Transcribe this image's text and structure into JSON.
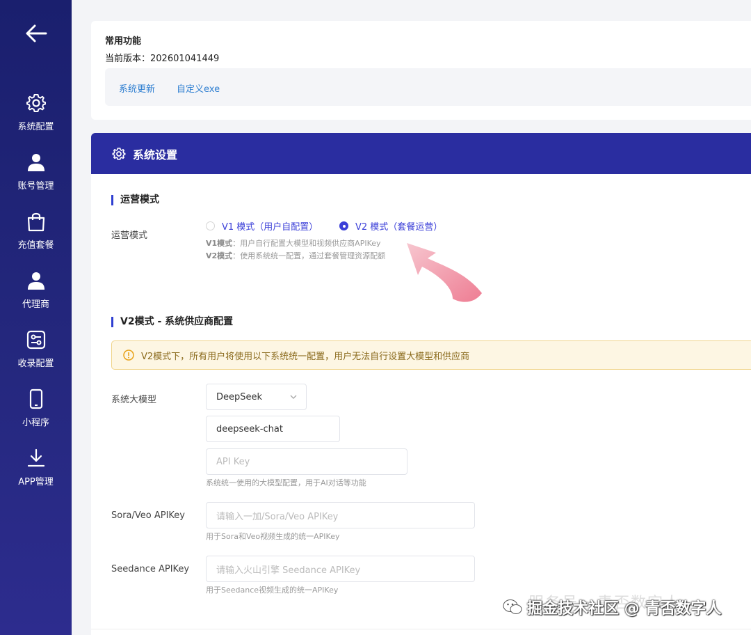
{
  "sidebar": {
    "back_icon": "arrow-left-icon",
    "items": [
      {
        "label": "系统配置",
        "icon": "gear-icon"
      },
      {
        "label": "账号管理",
        "icon": "user-icon"
      },
      {
        "label": "充值套餐",
        "icon": "shopping-bag-icon"
      },
      {
        "label": "代理商",
        "icon": "user-icon"
      },
      {
        "label": "收录配置",
        "icon": "settings-sliders-icon"
      },
      {
        "label": "小程序",
        "icon": "phone-icon"
      },
      {
        "label": "APP管理",
        "icon": "download-icon"
      }
    ]
  },
  "common": {
    "title": "常用功能",
    "version": "当前版本：202601041449",
    "links": [
      "系统更新",
      "自定义exe"
    ]
  },
  "settings": {
    "title": "系统设置",
    "mode_section": "运营模式",
    "mode_label": "运营模式",
    "options": [
      "V1 模式（用户自配置）",
      "V2 模式（套餐运营）"
    ],
    "selected_option": "V2 模式（套餐运营）",
    "hint_v1_key": "V1模式",
    "hint_v1_text": "：用户自行配置大模型和视频供应商APIKey",
    "hint_v2_key": "V2模式",
    "hint_v2_text": "：使用系统统一配置，通过套餐管理资源配额",
    "v2_section": "V2模式 - 系统供应商配置",
    "warning": "V2模式下，所有用户将使用以下系统统一配置，用户无法自行设置大模型和供应商",
    "llm_label": "系统大模型",
    "llm_provider": "DeepSeek",
    "llm_model": "deepseek-chat",
    "llm_key_placeholder": "API Key",
    "llm_help": "系统统一使用的大模型配置，用于AI对话等功能",
    "sora_label": "Sora/Veo APIKey",
    "sora_placeholder": "请输入一加/Sora/Veo APIKey",
    "sora_help": "用于Sora和Veo视频生成的统一APIKey",
    "seedance_label": "Seedance APIKey",
    "seedance_placeholder": "请输入火山引擎 Seedance APIKey",
    "seedance_help": "用于Seedance视频生成的统一APIKey"
  },
  "watermark": "掘金技术社区 @ 青否数字人",
  "watermark_bg": "服务号 · 青否数字人",
  "colors": {
    "sidebar": "#1a1f6e",
    "header": "#2a2da0",
    "accent": "#3b3fd8",
    "link": "#2f7fd1",
    "warning_bg": "#fdf6e3"
  }
}
